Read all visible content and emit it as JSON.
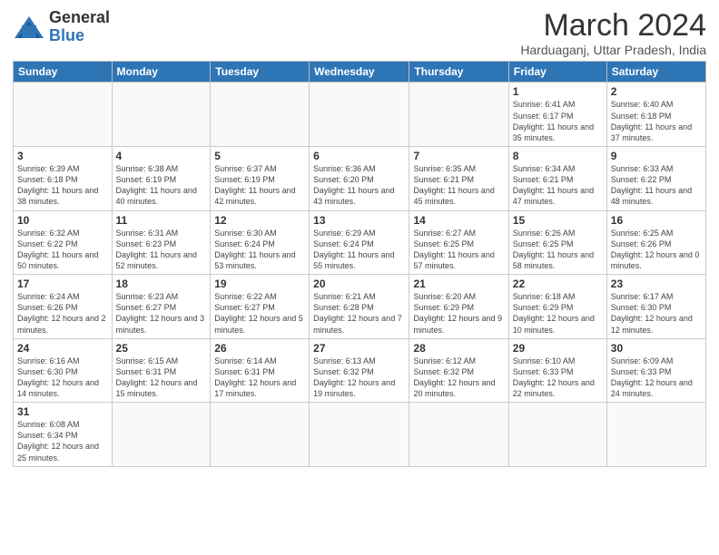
{
  "logo": {
    "general": "General",
    "blue": "Blue"
  },
  "title": "March 2024",
  "subtitle": "Harduaganj, Uttar Pradesh, India",
  "weekdays": [
    "Sunday",
    "Monday",
    "Tuesday",
    "Wednesday",
    "Thursday",
    "Friday",
    "Saturday"
  ],
  "weeks": [
    [
      {
        "day": "",
        "info": ""
      },
      {
        "day": "",
        "info": ""
      },
      {
        "day": "",
        "info": ""
      },
      {
        "day": "",
        "info": ""
      },
      {
        "day": "",
        "info": ""
      },
      {
        "day": "1",
        "info": "Sunrise: 6:41 AM\nSunset: 6:17 PM\nDaylight: 11 hours\nand 35 minutes."
      },
      {
        "day": "2",
        "info": "Sunrise: 6:40 AM\nSunset: 6:18 PM\nDaylight: 11 hours\nand 37 minutes."
      }
    ],
    [
      {
        "day": "3",
        "info": "Sunrise: 6:39 AM\nSunset: 6:18 PM\nDaylight: 11 hours\nand 38 minutes."
      },
      {
        "day": "4",
        "info": "Sunrise: 6:38 AM\nSunset: 6:19 PM\nDaylight: 11 hours\nand 40 minutes."
      },
      {
        "day": "5",
        "info": "Sunrise: 6:37 AM\nSunset: 6:19 PM\nDaylight: 11 hours\nand 42 minutes."
      },
      {
        "day": "6",
        "info": "Sunrise: 6:36 AM\nSunset: 6:20 PM\nDaylight: 11 hours\nand 43 minutes."
      },
      {
        "day": "7",
        "info": "Sunrise: 6:35 AM\nSunset: 6:21 PM\nDaylight: 11 hours\nand 45 minutes."
      },
      {
        "day": "8",
        "info": "Sunrise: 6:34 AM\nSunset: 6:21 PM\nDaylight: 11 hours\nand 47 minutes."
      },
      {
        "day": "9",
        "info": "Sunrise: 6:33 AM\nSunset: 6:22 PM\nDaylight: 11 hours\nand 48 minutes."
      }
    ],
    [
      {
        "day": "10",
        "info": "Sunrise: 6:32 AM\nSunset: 6:22 PM\nDaylight: 11 hours\nand 50 minutes."
      },
      {
        "day": "11",
        "info": "Sunrise: 6:31 AM\nSunset: 6:23 PM\nDaylight: 11 hours\nand 52 minutes."
      },
      {
        "day": "12",
        "info": "Sunrise: 6:30 AM\nSunset: 6:24 PM\nDaylight: 11 hours\nand 53 minutes."
      },
      {
        "day": "13",
        "info": "Sunrise: 6:29 AM\nSunset: 6:24 PM\nDaylight: 11 hours\nand 55 minutes."
      },
      {
        "day": "14",
        "info": "Sunrise: 6:27 AM\nSunset: 6:25 PM\nDaylight: 11 hours\nand 57 minutes."
      },
      {
        "day": "15",
        "info": "Sunrise: 6:26 AM\nSunset: 6:25 PM\nDaylight: 11 hours\nand 58 minutes."
      },
      {
        "day": "16",
        "info": "Sunrise: 6:25 AM\nSunset: 6:26 PM\nDaylight: 12 hours\nand 0 minutes."
      }
    ],
    [
      {
        "day": "17",
        "info": "Sunrise: 6:24 AM\nSunset: 6:26 PM\nDaylight: 12 hours\nand 2 minutes."
      },
      {
        "day": "18",
        "info": "Sunrise: 6:23 AM\nSunset: 6:27 PM\nDaylight: 12 hours\nand 3 minutes."
      },
      {
        "day": "19",
        "info": "Sunrise: 6:22 AM\nSunset: 6:27 PM\nDaylight: 12 hours\nand 5 minutes."
      },
      {
        "day": "20",
        "info": "Sunrise: 6:21 AM\nSunset: 6:28 PM\nDaylight: 12 hours\nand 7 minutes."
      },
      {
        "day": "21",
        "info": "Sunrise: 6:20 AM\nSunset: 6:29 PM\nDaylight: 12 hours\nand 9 minutes."
      },
      {
        "day": "22",
        "info": "Sunrise: 6:18 AM\nSunset: 6:29 PM\nDaylight: 12 hours\nand 10 minutes."
      },
      {
        "day": "23",
        "info": "Sunrise: 6:17 AM\nSunset: 6:30 PM\nDaylight: 12 hours\nand 12 minutes."
      }
    ],
    [
      {
        "day": "24",
        "info": "Sunrise: 6:16 AM\nSunset: 6:30 PM\nDaylight: 12 hours\nand 14 minutes."
      },
      {
        "day": "25",
        "info": "Sunrise: 6:15 AM\nSunset: 6:31 PM\nDaylight: 12 hours\nand 15 minutes."
      },
      {
        "day": "26",
        "info": "Sunrise: 6:14 AM\nSunset: 6:31 PM\nDaylight: 12 hours\nand 17 minutes."
      },
      {
        "day": "27",
        "info": "Sunrise: 6:13 AM\nSunset: 6:32 PM\nDaylight: 12 hours\nand 19 minutes."
      },
      {
        "day": "28",
        "info": "Sunrise: 6:12 AM\nSunset: 6:32 PM\nDaylight: 12 hours\nand 20 minutes."
      },
      {
        "day": "29",
        "info": "Sunrise: 6:10 AM\nSunset: 6:33 PM\nDaylight: 12 hours\nand 22 minutes."
      },
      {
        "day": "30",
        "info": "Sunrise: 6:09 AM\nSunset: 6:33 PM\nDaylight: 12 hours\nand 24 minutes."
      }
    ],
    [
      {
        "day": "31",
        "info": "Sunrise: 6:08 AM\nSunset: 6:34 PM\nDaylight: 12 hours\nand 25 minutes."
      },
      {
        "day": "",
        "info": ""
      },
      {
        "day": "",
        "info": ""
      },
      {
        "day": "",
        "info": ""
      },
      {
        "day": "",
        "info": ""
      },
      {
        "day": "",
        "info": ""
      },
      {
        "day": "",
        "info": ""
      }
    ]
  ]
}
